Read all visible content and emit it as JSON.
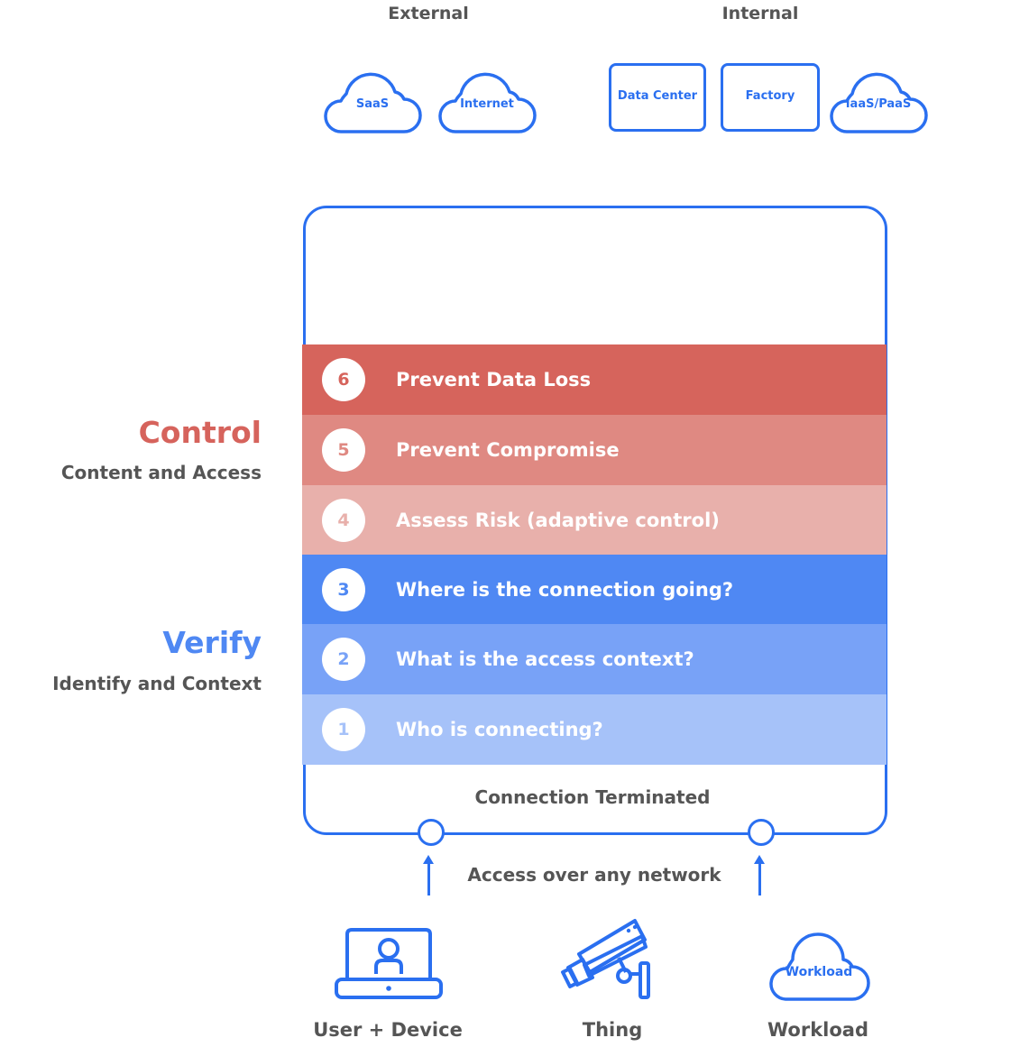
{
  "colors": {
    "accent_blue": "#2a6ff0",
    "control_red": "#d6635c",
    "verify_blue": "#4f88f3",
    "text_gray": "#555555"
  },
  "destinations": {
    "external": {
      "label": "External",
      "items": [
        {
          "label": "SaaS",
          "shape": "cloud-icon"
        },
        {
          "label": "Internet",
          "shape": "cloud-icon"
        }
      ]
    },
    "internal": {
      "label": "Internal",
      "items": [
        {
          "label": "Data Center",
          "shape": "box"
        },
        {
          "label": "Factory",
          "shape": "box"
        },
        {
          "label": "IaaS/PaaS",
          "shape": "cloud-icon"
        }
      ]
    }
  },
  "side_labels": {
    "control": {
      "title": "Control",
      "subtitle": "Content and Access"
    },
    "verify": {
      "title": "Verify",
      "subtitle": "Identify and Context"
    }
  },
  "steps": [
    {
      "number": "6",
      "label": "Prevent Data Loss",
      "bg": "#d6645c",
      "num_color": "#d6645c"
    },
    {
      "number": "5",
      "label": "Prevent Compromise",
      "bg": "#df8982",
      "num_color": "#df8982"
    },
    {
      "number": "4",
      "label": "Assess Risk (adaptive control)",
      "bg": "#e8b0ab",
      "num_color": "#e8b0ab"
    },
    {
      "number": "3",
      "label": "Where is the connection going?",
      "bg": "#4f88f3",
      "num_color": "#4f88f3"
    },
    {
      "number": "2",
      "label": "What is the access context?",
      "bg": "#78a2f7",
      "num_color": "#78a2f7"
    },
    {
      "number": "1",
      "label": "Who is connecting?",
      "bg": "#a6c2f9",
      "num_color": "#a6c2f9"
    }
  ],
  "box_caption": "Connection Terminated",
  "network_caption": "Access over any network",
  "sources": [
    {
      "label": "User + Device",
      "icon": "laptop-user-icon"
    },
    {
      "label": "Thing",
      "icon": "security-camera-icon"
    },
    {
      "label": "Workload",
      "icon": "cloud-icon",
      "inner_label": "Workload"
    }
  ]
}
